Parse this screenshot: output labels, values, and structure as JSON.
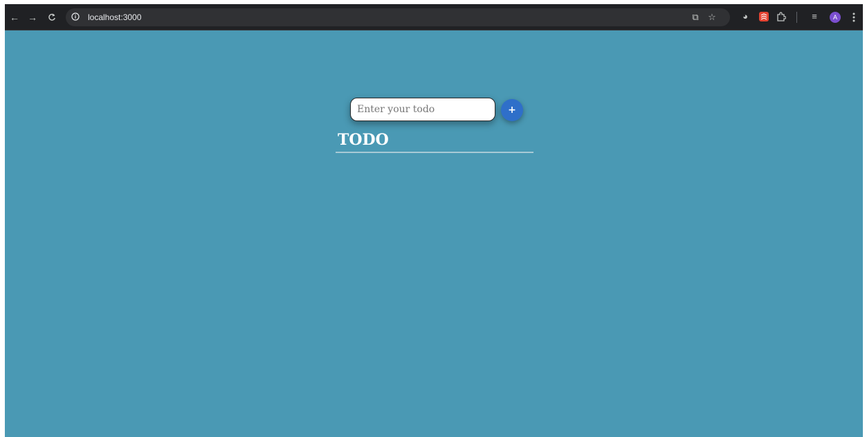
{
  "browser": {
    "url": "localhost:3000",
    "profile_initial": "A",
    "icons": {
      "back": "back-arrow-icon",
      "forward": "forward-arrow-icon",
      "reload": "reload-icon",
      "site_info": "info-icon",
      "cast": "cast-icon",
      "bookmark": "star-icon",
      "extensions": [
        "timer-extension-icon",
        "todoist-extension-icon",
        "puzzle-extensions-icon"
      ],
      "reading_list": "reading-list-icon",
      "menu": "kebab-menu-icon"
    }
  },
  "app": {
    "input_placeholder": "Enter your todo",
    "input_value": "",
    "add_button_label": "+",
    "heading": "TODO",
    "todos": []
  },
  "colors": {
    "page_background": "#4a99b4",
    "add_button": "#2f6fc9",
    "heading_text": "#ffffff",
    "heading_rule": "#a7c9d5",
    "toolbar": "#202124",
    "avatar": "#7b4fd0"
  }
}
